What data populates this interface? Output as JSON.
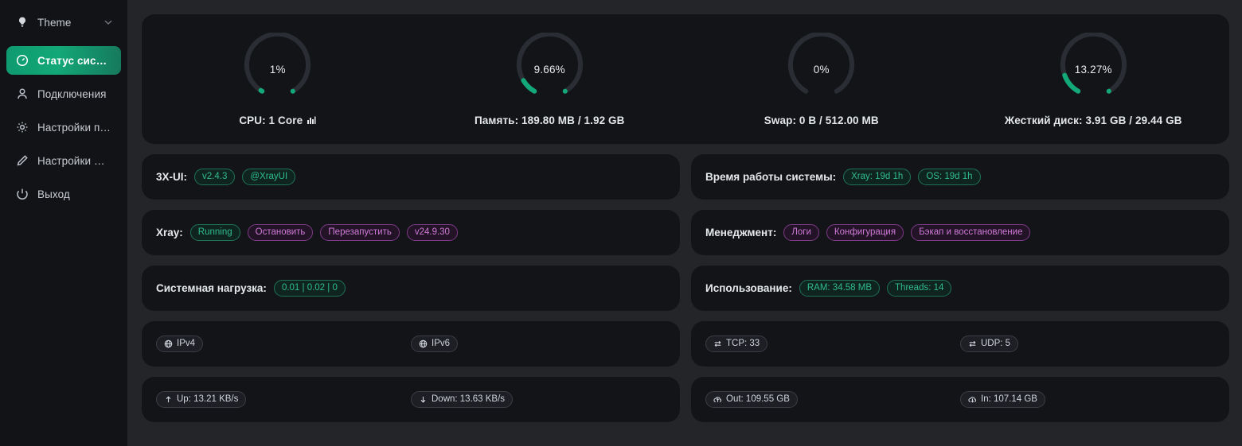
{
  "sidebar": {
    "theme": {
      "label": "Theme",
      "icon": "bulb-icon",
      "chevron": "chevron-down-icon"
    },
    "items": [
      {
        "label": "Статус системы",
        "icon": "gauge-icon",
        "active": true
      },
      {
        "label": "Подключения",
        "icon": "user-icon",
        "active": false
      },
      {
        "label": "Настройки па...",
        "icon": "gear-icon",
        "active": false
      },
      {
        "label": "Настройки Xray",
        "icon": "pen-icon",
        "active": false
      },
      {
        "label": "Выход",
        "icon": "logout-icon",
        "active": false
      }
    ]
  },
  "gauges": [
    {
      "name": "cpu",
      "value": "1%",
      "percent": 1,
      "caption": "CPU: 1 Core",
      "has_chart_icon": true
    },
    {
      "name": "memory",
      "value": "9.66%",
      "percent": 9.66,
      "caption": "Память: 189.80 MB / 1.92 GB",
      "has_chart_icon": false
    },
    {
      "name": "swap",
      "value": "0%",
      "percent": 0,
      "caption": "Swap: 0 B / 512.00 MB",
      "has_chart_icon": false
    },
    {
      "name": "disk",
      "value": "13.27%",
      "percent": 13.27,
      "caption": "Жесткий диск: 3.91 GB / 29.44 GB",
      "has_chart_icon": false
    }
  ],
  "panels": {
    "xui": {
      "label": "3X-UI:",
      "chips": [
        {
          "text": "v2.4.3",
          "style": "green"
        },
        {
          "text": "@XrayUI",
          "style": "green"
        }
      ]
    },
    "uptime": {
      "label": "Время работы системы:",
      "chips": [
        {
          "text": "Xray: 19d 1h",
          "style": "green"
        },
        {
          "text": "OS: 19d 1h",
          "style": "green"
        }
      ]
    },
    "xray": {
      "label": "Xray:",
      "chips": [
        {
          "text": "Running",
          "style": "green"
        },
        {
          "text": "Остановить",
          "style": "purple"
        },
        {
          "text": "Перезапустить",
          "style": "purple"
        },
        {
          "text": "v24.9.30",
          "style": "purple"
        }
      ]
    },
    "management": {
      "label": "Менеджмент:",
      "chips": [
        {
          "text": "Логи",
          "style": "purple"
        },
        {
          "text": "Конфигурация",
          "style": "purple"
        },
        {
          "text": "Бэкап и восстановление",
          "style": "purple"
        }
      ]
    },
    "load": {
      "label": "Системная нагрузка:",
      "chips": [
        {
          "text": "0.01 | 0.02 | 0",
          "style": "green"
        }
      ]
    },
    "usage": {
      "label": "Использование:",
      "chips": [
        {
          "text": "RAM: 34.58 MB",
          "style": "green"
        },
        {
          "text": "Threads: 14",
          "style": "green"
        }
      ]
    },
    "ip": {
      "left": {
        "text": "IPv4",
        "style": "grey",
        "icon": "globe-icon"
      },
      "right": {
        "text": "IPv6",
        "style": "grey",
        "icon": "globe-icon"
      }
    },
    "ports": {
      "left": {
        "text": "TCP: 33",
        "style": "grey",
        "icon": "exchange-icon"
      },
      "right": {
        "text": "UDP: 5",
        "style": "grey",
        "icon": "exchange-icon"
      }
    },
    "speed": {
      "left": {
        "text": "Up: 13.21 KB/s",
        "style": "grey",
        "icon": "arrow-up-icon"
      },
      "right": {
        "text": "Down: 13.63 KB/s",
        "style": "grey",
        "icon": "arrow-down-icon"
      }
    },
    "traffic": {
      "left": {
        "text": "Out: 109.55 GB",
        "style": "grey",
        "icon": "cloud-upload-icon"
      },
      "right": {
        "text": "In: 107.14 GB",
        "style": "grey",
        "icon": "cloud-download-icon"
      }
    }
  },
  "colors": {
    "accent": "#13a877",
    "page_bg": "#232529",
    "card_bg": "#131417",
    "sidebar_bg": "#121317",
    "track": "#2a2d33",
    "purple": "#cf7ad6"
  }
}
